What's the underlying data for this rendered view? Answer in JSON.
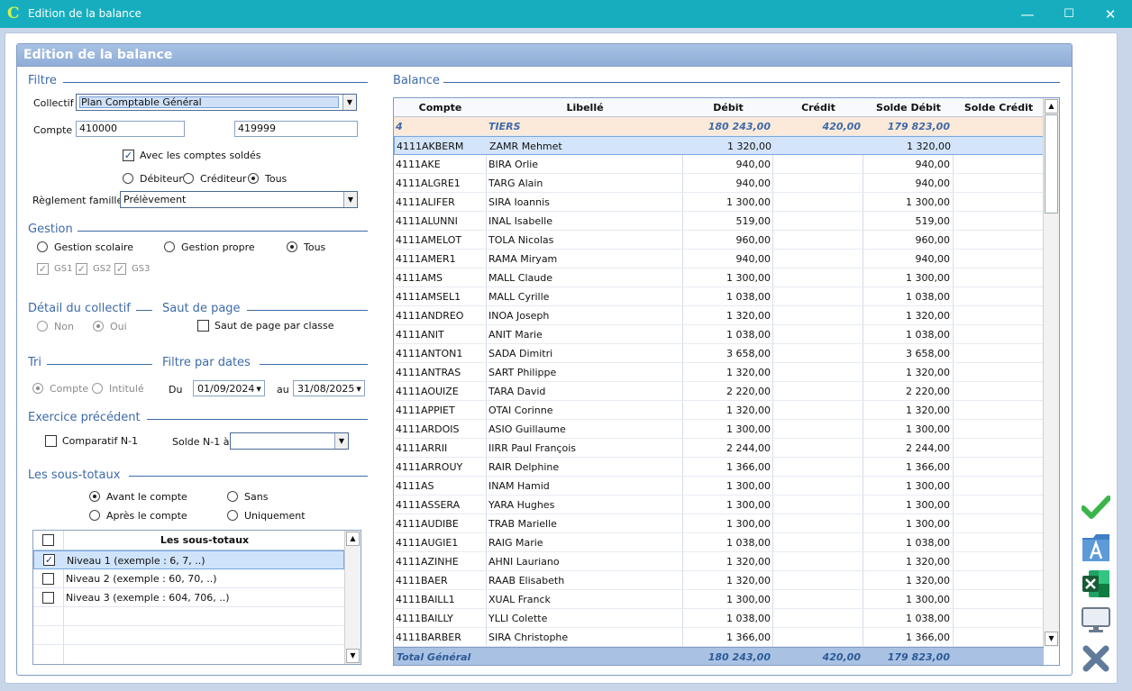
{
  "window": {
    "title": "Edition de la balance",
    "app_icon": "C",
    "minimize": "—",
    "maximize": "☐",
    "close": "✕"
  },
  "panel": {
    "title": "Edition de la balance"
  },
  "filtre": {
    "title": "Filtre",
    "collectif_label": "Collectif",
    "collectif_value": "Plan Comptable Général",
    "compte_label": "Compte",
    "compte_from": "410000",
    "compte_to": "419999",
    "soldes_label": "Avec les comptes soldés",
    "debiteur": "Débiteur",
    "crediteur": "Créditeur",
    "tous": "Tous",
    "reglement_label": "Règlement famille",
    "reglement_value": "Prélèvement"
  },
  "gestion": {
    "title": "Gestion",
    "scolaire": "Gestion scolaire",
    "propre": "Gestion propre",
    "tous": "Tous",
    "gs1": "GS1",
    "gs2": "GS2",
    "gs3": "GS3"
  },
  "detail": {
    "title": "Détail du collectif",
    "non": "Non",
    "oui": "Oui"
  },
  "saut": {
    "title": "Saut de page",
    "label": "Saut de page par classe"
  },
  "tri": {
    "title": "Tri",
    "compte": "Compte",
    "intitule": "Intitulé"
  },
  "dates": {
    "title": "Filtre par dates",
    "du_label": "Du",
    "du_value": "01/09/2024",
    "au_label": "au",
    "au_value": "31/08/2025"
  },
  "exercice": {
    "title": "Exercice précédent",
    "comparatif": "Comparatif N-1",
    "solde_label": "Solde N-1 à",
    "solde_value": ""
  },
  "soustotaux": {
    "title": "Les sous-totaux",
    "avant": "Avant le compte",
    "sans": "Sans",
    "apres": "Après le compte",
    "uniquement": "Uniquement",
    "grid_header": "Les sous-totaux",
    "rows": [
      {
        "label": "Niveau 1 (exemple : 6, 7, ..)",
        "checked": true
      },
      {
        "label": "Niveau 2 (exemple : 60, 70, ..)",
        "checked": false
      },
      {
        "label": "Niveau 3 (exemple : 604, 706, ..)",
        "checked": false
      }
    ]
  },
  "balance": {
    "title": "Balance",
    "columns": [
      "Compte",
      "Libellé",
      "Débit",
      "Crédit",
      "Solde Débit",
      "Solde Crédit"
    ],
    "subtotal": {
      "compte": "4",
      "libelle": "TIERS",
      "debit": "180 243,00",
      "credit": "420,00",
      "solde_debit": "179 823,00",
      "solde_credit": ""
    },
    "rows": [
      [
        "4111AKBERM",
        "ZAMR Mehmet",
        "1 320,00",
        "",
        "1 320,00",
        ""
      ],
      [
        "4111AKE",
        "BIRA Orlie",
        "940,00",
        "",
        "940,00",
        ""
      ],
      [
        "4111ALGRE1",
        "TARG Alain",
        "940,00",
        "",
        "940,00",
        ""
      ],
      [
        "4111ALIFER",
        "SIRA Ioannis",
        "1 300,00",
        "",
        "1 300,00",
        ""
      ],
      [
        "4111ALUNNI",
        "INAL Isabelle",
        "519,00",
        "",
        "519,00",
        ""
      ],
      [
        "4111AMELOT",
        "TOLA Nicolas",
        "960,00",
        "",
        "960,00",
        ""
      ],
      [
        "4111AMER1",
        "RAMA Miryam",
        "940,00",
        "",
        "940,00",
        ""
      ],
      [
        "4111AMS",
        "MALL Claude",
        "1 300,00",
        "",
        "1 300,00",
        ""
      ],
      [
        "4111AMSEL1",
        "MALL Cyrille",
        "1 038,00",
        "",
        "1 038,00",
        ""
      ],
      [
        "4111ANDREO",
        "INOA Joseph",
        "1 320,00",
        "",
        "1 320,00",
        ""
      ],
      [
        "4111ANIT",
        "ANIT Marie",
        "1 038,00",
        "",
        "1 038,00",
        ""
      ],
      [
        "4111ANTON1",
        "SADA Dimitri",
        "3 658,00",
        "",
        "3 658,00",
        ""
      ],
      [
        "4111ANTRAS",
        "SART Philippe",
        "1 320,00",
        "",
        "1 320,00",
        ""
      ],
      [
        "4111AOUIZE",
        "TARA David",
        "2 220,00",
        "",
        "2 220,00",
        ""
      ],
      [
        "4111APPIET",
        "OTAI Corinne",
        "1 320,00",
        "",
        "1 320,00",
        ""
      ],
      [
        "4111ARDOIS",
        "ASIO Guillaume",
        "1 300,00",
        "",
        "1 300,00",
        ""
      ],
      [
        "4111ARRII",
        "IIRR Paul François",
        "2 244,00",
        "",
        "2 244,00",
        ""
      ],
      [
        "4111ARROUY",
        "RAIR Delphine",
        "1 366,00",
        "",
        "1 366,00",
        ""
      ],
      [
        "4111AS",
        "INAM Hamid",
        "1 300,00",
        "",
        "1 300,00",
        ""
      ],
      [
        "4111ASSERA",
        "YARA Hughes",
        "1 300,00",
        "",
        "1 300,00",
        ""
      ],
      [
        "4111AUDIBE",
        "TRAB Marielle",
        "1 300,00",
        "",
        "1 300,00",
        ""
      ],
      [
        "4111AUGIE1",
        "RAIG Marie",
        "1 038,00",
        "",
        "1 038,00",
        ""
      ],
      [
        "4111AZINHE",
        "AHNI Lauriano",
        "1 320,00",
        "",
        "1 320,00",
        ""
      ],
      [
        "4111BAER",
        "RAAB Elisabeth",
        "1 320,00",
        "",
        "1 320,00",
        ""
      ],
      [
        "4111BAILL1",
        "XUAL Franck",
        "1 300,00",
        "",
        "1 300,00",
        ""
      ],
      [
        "4111BAILLY",
        "YLLI Colette",
        "1 038,00",
        "",
        "1 038,00",
        ""
      ],
      [
        "4111BARBER",
        "SIRA Christophe",
        "1 366,00",
        "",
        "1 366,00",
        ""
      ]
    ],
    "total": {
      "label": "Total Général",
      "debit": "180 243,00",
      "credit": "420,00",
      "solde_debit": "179 823,00",
      "solde_credit": ""
    }
  },
  "colors": {
    "accent": "#16aebe",
    "header": "#8fadd8",
    "group_title": "#3d6aa8",
    "check_green": "#3bb54a"
  }
}
